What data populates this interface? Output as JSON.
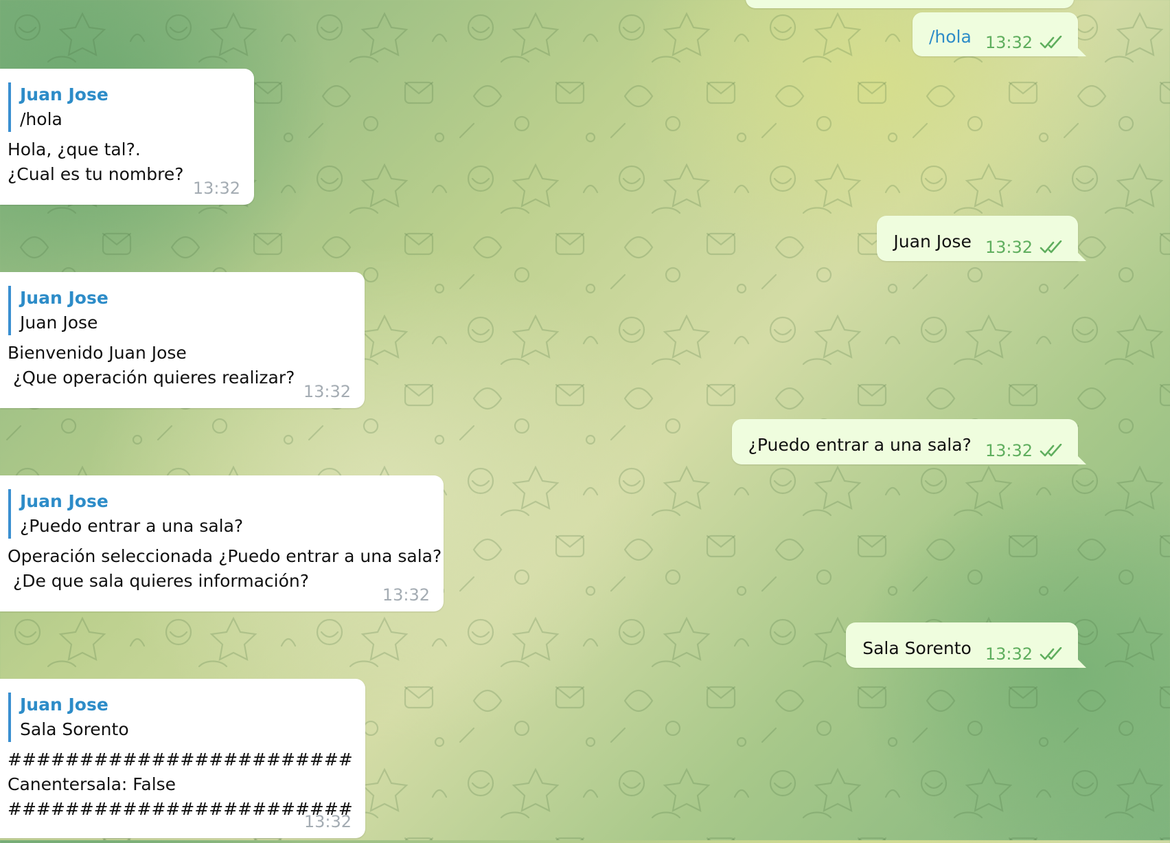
{
  "chat": {
    "outgoing": [
      {
        "text": "/hola",
        "time": "13:32",
        "is_command": true
      },
      {
        "text": "Juan Jose",
        "time": "13:32"
      },
      {
        "text": "¿Puedo entrar a una sala?",
        "time": "13:32"
      },
      {
        "text": "Sala Sorento",
        "time": "13:32"
      }
    ],
    "incoming": [
      {
        "reply_author": "Juan Jose",
        "reply_text": "/hola",
        "lines": [
          "Hola, ¿que tal?.",
          "¿Cual es tu nombre?"
        ],
        "time": "13:32"
      },
      {
        "reply_author": "Juan Jose",
        "reply_text": "Juan Jose",
        "lines": [
          "Bienvenido Juan Jose",
          " ¿Que operación quieres realizar?"
        ],
        "time": "13:32"
      },
      {
        "reply_author": "Juan Jose",
        "reply_text": "¿Puedo entrar a una sala?",
        "lines": [
          "Operación seleccionada ¿Puedo entrar a una sala?",
          " ¿De que sala quieres información?"
        ],
        "time": "13:32"
      },
      {
        "reply_author": "Juan Jose",
        "reply_text": "Sala Sorento",
        "lines": [
          "########################",
          "Canentersala: False",
          "########################"
        ],
        "time": "13:32"
      }
    ]
  }
}
